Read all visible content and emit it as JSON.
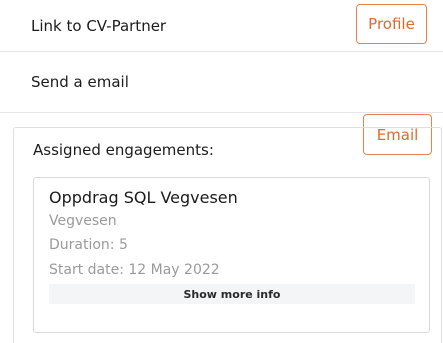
{
  "links": {
    "cv_partner": {
      "label": "Link to CV-Partner",
      "button_label": "Profile"
    },
    "email": {
      "label": "Send a email",
      "button_label": "Email"
    }
  },
  "engagements": {
    "title": "Assigned engagements:",
    "items": [
      {
        "name": "Oppdrag SQL Vegvesen",
        "client": "Vegvesen",
        "duration": "Duration: 5",
        "start_date": "Start date: 12 May 2022",
        "show_more_label": "Show more info"
      }
    ]
  },
  "colors": {
    "accent": "#e06a2c",
    "accent_border": "#e8824f",
    "muted_text": "#9a9a9a",
    "divider": "#e6e6e6",
    "show_more_bg": "#f4f5f7"
  }
}
